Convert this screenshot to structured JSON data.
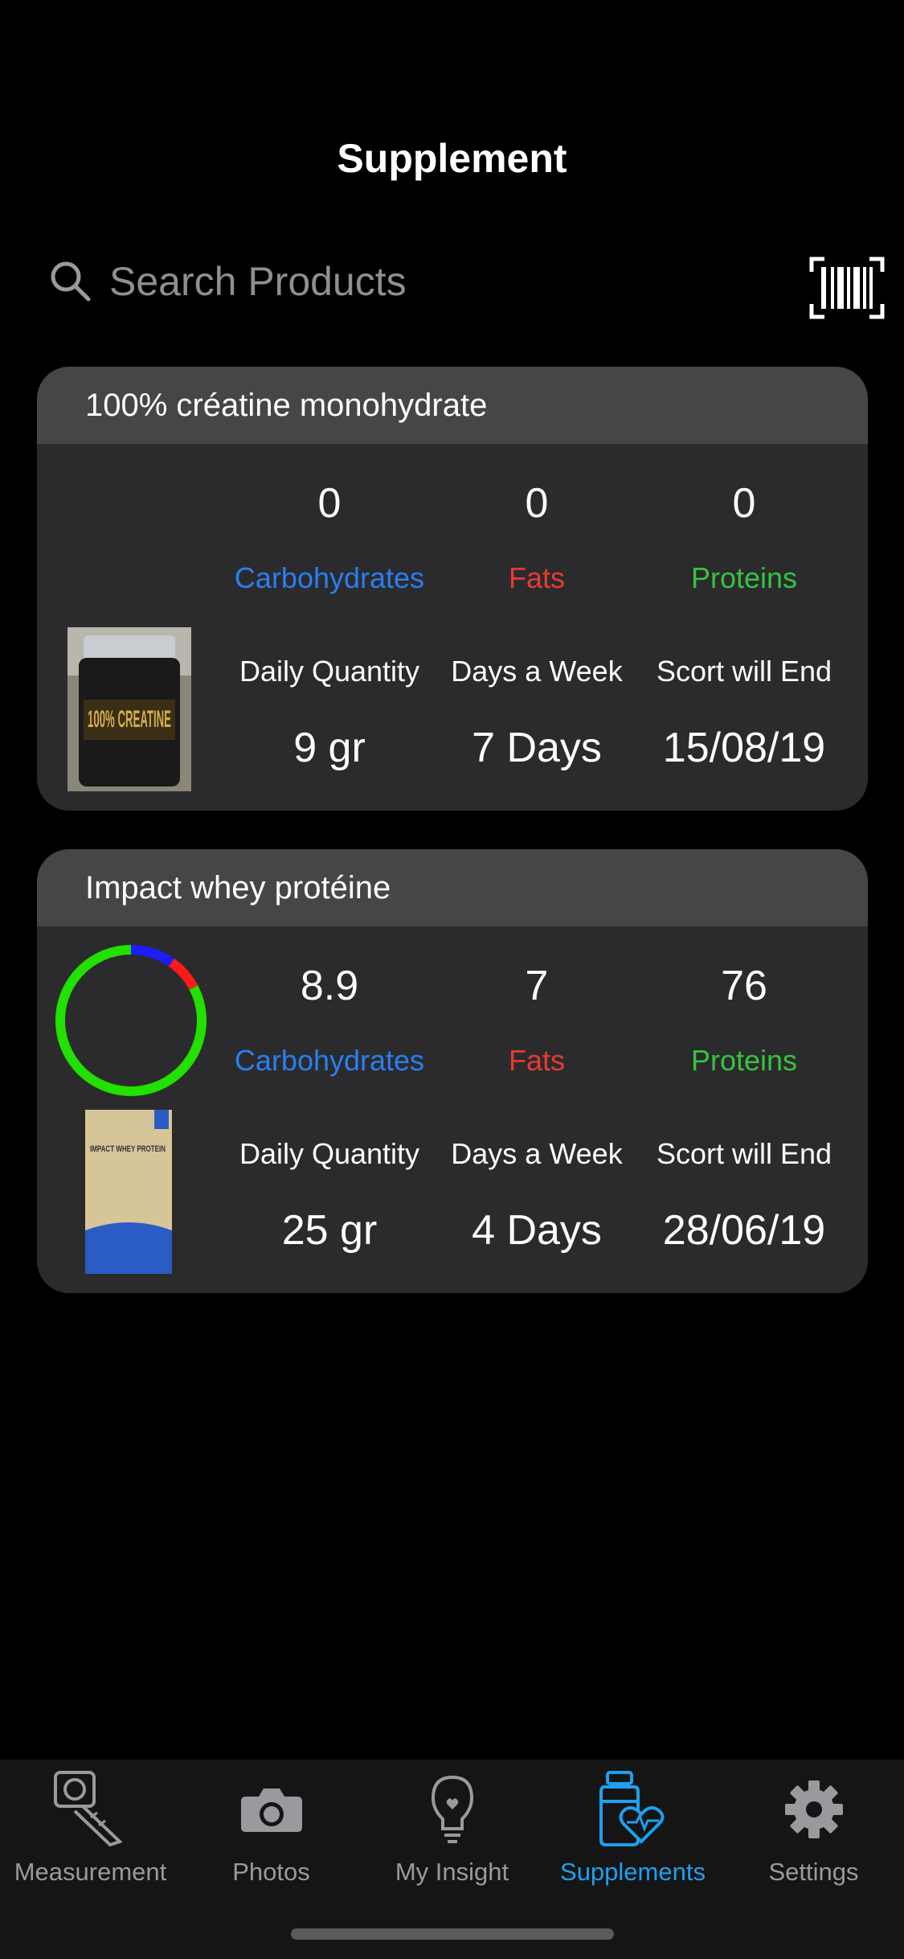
{
  "header": {
    "title": "Supplement"
  },
  "search": {
    "placeholder": "Search Products",
    "value": ""
  },
  "cards": [
    {
      "name": "100% créatine monohydrate",
      "macros": [
        {
          "value": "0",
          "label": "Carbohydrates",
          "color": "#2a7ff0"
        },
        {
          "value": "0",
          "label": "Fats",
          "color": "#e63b33"
        },
        {
          "value": "0",
          "label": "Proteins",
          "color": "#35c43f"
        }
      ],
      "details": [
        {
          "label": "Daily Quantity",
          "value": "9 gr"
        },
        {
          "label": "Days a Week",
          "value": "7 Days"
        },
        {
          "label": "Scort will End",
          "value": "15/08/19"
        }
      ],
      "image_label": "100% CREATINE"
    },
    {
      "name": "Impact whey protéine",
      "macros": [
        {
          "value": "8.9",
          "label": "Carbohydrates",
          "color": "#2a7ff0"
        },
        {
          "value": "7",
          "label": "Fats",
          "color": "#e63b33"
        },
        {
          "value": "76",
          "label": "Proteins",
          "color": "#35c43f"
        }
      ],
      "details": [
        {
          "label": "Daily Quantity",
          "value": "25 gr"
        },
        {
          "label": "Days a Week",
          "value": "4 Days"
        },
        {
          "label": "Scort will End",
          "value": "28/06/19"
        }
      ],
      "image_label": "IMPACT WHEY PROTEIN"
    }
  ],
  "tabs": [
    {
      "label": "Measurement",
      "icon": "measuring-tape-icon",
      "active": false
    },
    {
      "label": "Photos",
      "icon": "camera-icon",
      "active": false
    },
    {
      "label": "My Insight",
      "icon": "lightbulb-icon",
      "active": false
    },
    {
      "label": "Supplements",
      "icon": "supplements-heart-icon",
      "active": true
    },
    {
      "label": "Settings",
      "icon": "gear-icon",
      "active": false
    }
  ],
  "colors": {
    "accent": "#1ea0f0",
    "card_bg": "#2b2b2d",
    "header_bg": "#464648"
  }
}
